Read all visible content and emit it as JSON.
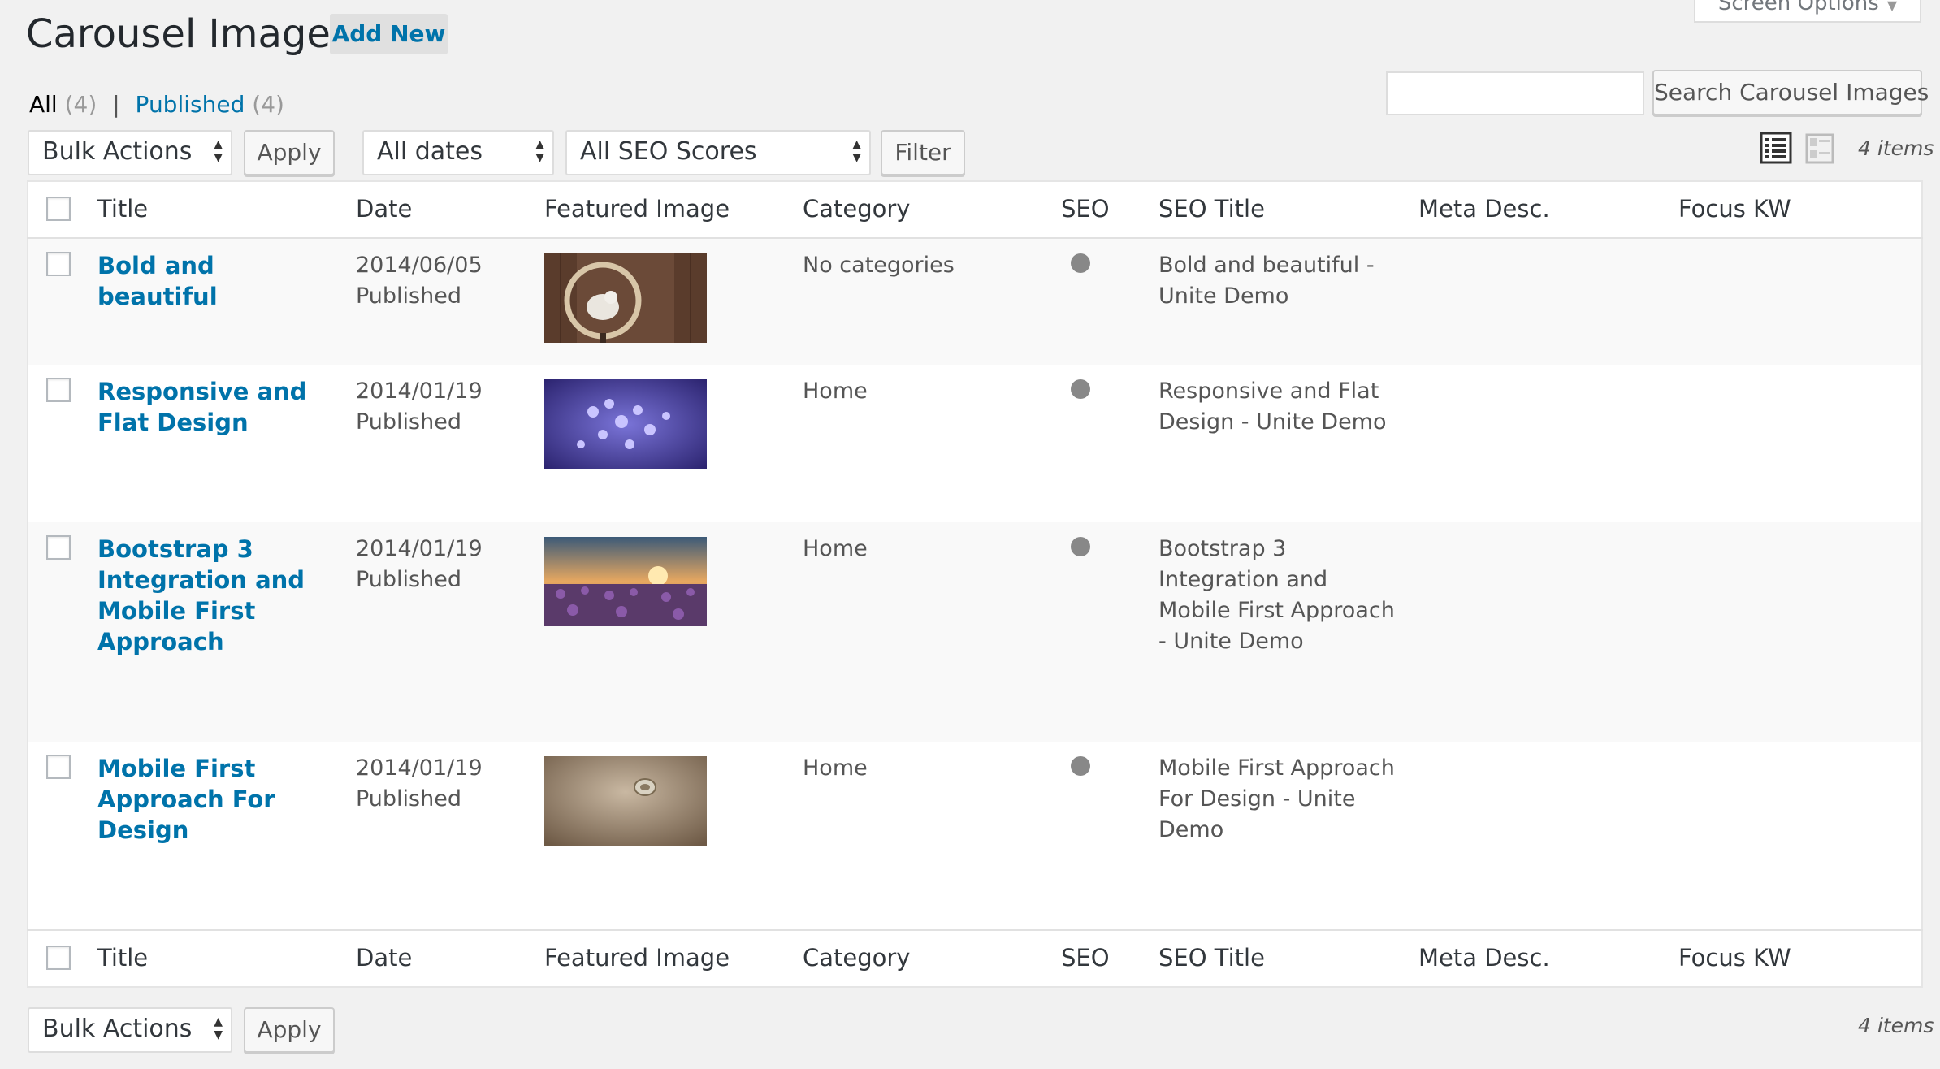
{
  "header": {
    "title": "Carousel Images",
    "add_new_label": "Add New",
    "screen_options_label": "Screen Options"
  },
  "filters_nav": {
    "all_label": "All",
    "all_count": "(4)",
    "separator": "|",
    "published_label": "Published",
    "published_count": "(4)"
  },
  "search": {
    "value": "",
    "button_label": "Search Carousel Images"
  },
  "tablenav_top": {
    "bulk_actions": "Bulk Actions",
    "apply_label": "Apply",
    "dates_filter": "All dates",
    "seo_filter": "All SEO Scores",
    "filter_label": "Filter",
    "items_count": "4 items"
  },
  "table": {
    "columns": {
      "title": "Title",
      "date": "Date",
      "featured_image": "Featured Image",
      "category": "Category",
      "seo": "SEO",
      "seo_title": "SEO Title",
      "meta_desc": "Meta Desc.",
      "focus_kw": "Focus KW"
    },
    "rows": [
      {
        "title": "Bold and beautiful",
        "date": "2014/06/05",
        "status": "Published",
        "category": "No categories",
        "seo_title": "Bold and beautiful - Unite Demo",
        "image": "bird-in-ring"
      },
      {
        "title": "Responsive and Flat Design",
        "date": "2014/01/19",
        "status": "Published",
        "category": "Home",
        "seo_title": "Responsive and Flat Design - Unite Demo",
        "image": "purple-flowers"
      },
      {
        "title": "Bootstrap 3 Integration and Mobile First Approach",
        "date": "2014/01/19",
        "status": "Published",
        "category": "Home",
        "seo_title": "Bootstrap 3 Integration and Mobile First Approach - Unite Demo",
        "image": "sunset-field"
      },
      {
        "title": "Mobile First Approach For Design",
        "date": "2014/01/19",
        "status": "Published",
        "category": "Home",
        "seo_title": "Mobile First Approach For Design - Unite Demo",
        "image": "ring-on-sand"
      }
    ]
  },
  "tablenav_bottom": {
    "bulk_actions": "Bulk Actions",
    "apply_label": "Apply",
    "items_count": "4 items"
  },
  "colors": {
    "link": "#0073aa",
    "background": "#f1f1f1",
    "seo_dot": "#888888"
  }
}
